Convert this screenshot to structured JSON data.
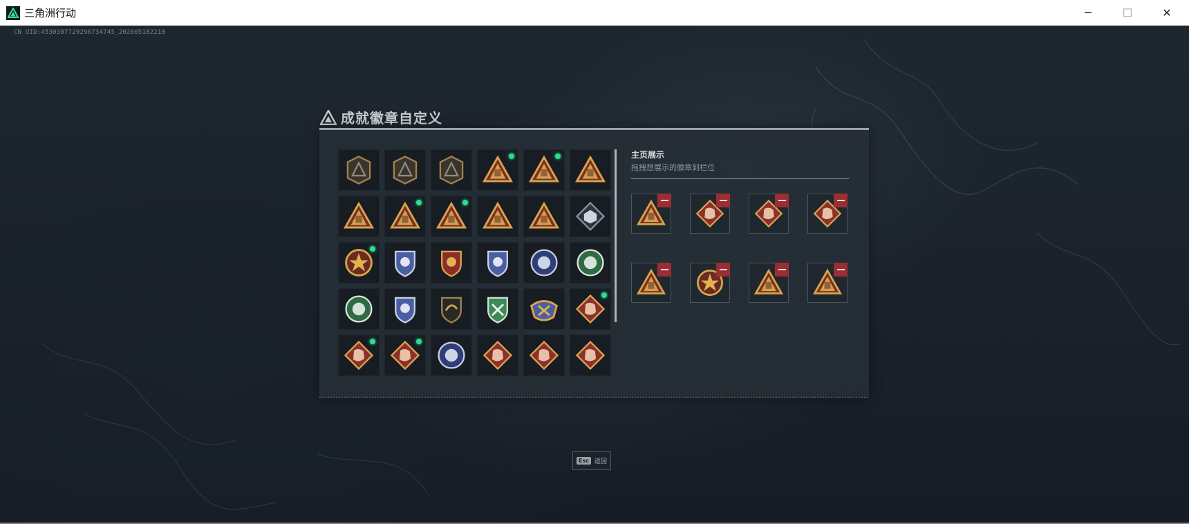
{
  "window": {
    "title": "三角洲行动",
    "minimize_label": "─",
    "maximize_label": "☐",
    "close_label": "✕"
  },
  "uid_text": "CN UID:4530387729296734745_202605182210",
  "dialog": {
    "title": "成就徽章自定义",
    "showcase_title": "主页展示",
    "showcase_subtitle": "拖拽想展示的徽章到栏位"
  },
  "badges": [
    {
      "icon": "delta-triangle-icon",
      "style": "bronze-hex",
      "new": false
    },
    {
      "icon": "helicopter-icon",
      "style": "bronze-hex",
      "new": false
    },
    {
      "icon": "dagger-shield-icon",
      "style": "bronze-hex",
      "new": false
    },
    {
      "icon": "s6-triangle-icon",
      "style": "gold-triangle",
      "new": true
    },
    {
      "icon": "backpack-triangle-icon",
      "style": "gold-triangle",
      "new": true
    },
    {
      "icon": "hand-sign-triangle-icon",
      "style": "gold-triangle",
      "new": false
    },
    {
      "icon": "helmet-triangle-icon",
      "style": "gold-triangle",
      "new": false
    },
    {
      "icon": "number-one-triangle-icon",
      "style": "gold-triangle",
      "new": true
    },
    {
      "icon": "backpack-triangle-icon",
      "style": "gold-triangle",
      "new": true
    },
    {
      "icon": "wolf-triangle-icon",
      "style": "gold-triangle",
      "new": false
    },
    {
      "icon": "tower-triangle-icon",
      "style": "gold-triangle",
      "new": false
    },
    {
      "icon": "cube-diamond-icon",
      "style": "silver-diamond",
      "new": false
    },
    {
      "icon": "star-wreath-icon",
      "style": "gold-star",
      "new": true
    },
    {
      "icon": "eagle-shield-icon",
      "style": "blue-shield",
      "new": false
    },
    {
      "icon": "crest-shield-icon",
      "style": "red-shield",
      "new": false
    },
    {
      "icon": "eagle-shield-icon",
      "style": "blue-shield",
      "new": false
    },
    {
      "icon": "globe-badge-icon",
      "style": "blue-round",
      "new": false
    },
    {
      "icon": "skull-laurel-icon",
      "style": "green-round",
      "new": false
    },
    {
      "icon": "sunburst-badge-icon",
      "style": "green-round",
      "new": false
    },
    {
      "icon": "crossed-rifles-shield-icon",
      "style": "blue-shield",
      "new": false
    },
    {
      "icon": "dragon-shield-icon",
      "style": "dark-shield",
      "new": false
    },
    {
      "icon": "crossed-rifles-shield-icon",
      "style": "green-shield",
      "new": false
    },
    {
      "icon": "wings-crest-icon",
      "style": "gold-wings",
      "new": false
    },
    {
      "icon": "tiger-diamond-icon",
      "style": "red-diamond",
      "new": true
    },
    {
      "icon": "tiger-diamond-icon",
      "style": "red-diamond",
      "new": true
    },
    {
      "icon": "runner-diamond-icon",
      "style": "red-diamond",
      "new": true
    },
    {
      "icon": "horse-round-icon",
      "style": "blue-round",
      "new": false
    },
    {
      "icon": "armor-diamond-icon",
      "style": "red-diamond",
      "new": false
    },
    {
      "icon": "rifle-diamond-icon",
      "style": "red-diamond",
      "new": false
    },
    {
      "icon": "vest-diamond-icon",
      "style": "red-diamond",
      "new": false
    }
  ],
  "showcase_slots": [
    {
      "icon": "backpack-triangle-icon",
      "style": "gold-triangle"
    },
    {
      "icon": "tiger-diamond-icon",
      "style": "red-diamond"
    },
    {
      "icon": "runner-diamond-icon",
      "style": "red-diamond"
    },
    {
      "icon": "tiger-diamond-icon",
      "style": "red-diamond"
    },
    {
      "icon": "backpack-triangle-icon",
      "style": "gold-triangle"
    },
    {
      "icon": "star-wreath-icon",
      "style": "gold-star"
    },
    {
      "icon": "s6-triangle-icon",
      "style": "gold-triangle"
    },
    {
      "icon": "number-one-triangle-icon",
      "style": "gold-triangle"
    }
  ],
  "back_button": {
    "key": "Esc",
    "label": "返回"
  },
  "colors": {
    "accent_green": "#27e08f",
    "remove_red": "#9b2e33",
    "gold": "#d8a64a",
    "bronze": "#a08350",
    "red_badge": "#8e2f2f",
    "blue_badge": "#4a5fa3",
    "green_badge": "#3d8a55"
  }
}
